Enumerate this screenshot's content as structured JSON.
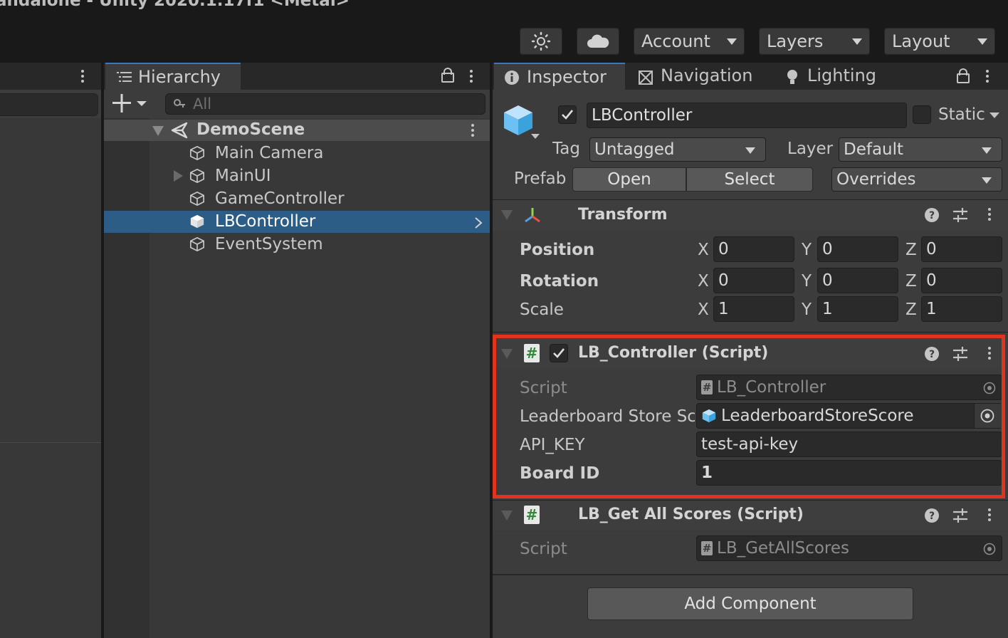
{
  "window": {
    "title": "andalone - Unity 2020.1.17f1 <Metal>"
  },
  "toolbar": {
    "account_label": "Account",
    "layers_label": "Layers",
    "layout_label": "Layout"
  },
  "hierarchy": {
    "tab_label": "Hierarchy",
    "search_placeholder": "All",
    "scene_name": "DemoScene",
    "items": [
      {
        "label": "Main Camera"
      },
      {
        "label": "MainUI"
      },
      {
        "label": "GameController"
      },
      {
        "label": "LBController"
      },
      {
        "label": "EventSystem"
      }
    ]
  },
  "inspector": {
    "tabs": [
      {
        "label": "Inspector"
      },
      {
        "label": "Navigation"
      },
      {
        "label": "Lighting"
      }
    ],
    "object_name": "LBController",
    "static_label": "Static",
    "tag_label": "Tag",
    "tag_value": "Untagged",
    "layer_label": "Layer",
    "layer_value": "Default",
    "prefab_label": "Prefab",
    "open_label": "Open",
    "select_label": "Select",
    "overrides_label": "Overrides",
    "transform": {
      "title": "Transform",
      "position_label": "Position",
      "rotation_label": "Rotation",
      "scale_label": "Scale",
      "x": "X",
      "y": "Y",
      "z": "Z",
      "position": [
        "0",
        "0",
        "0"
      ],
      "rotation": [
        "0",
        "0",
        "0"
      ],
      "scale": [
        "1",
        "1",
        "1"
      ]
    },
    "lb_controller": {
      "title": "LB_Controller (Script)",
      "script_label": "Script",
      "script_value": "LB_Controller",
      "store_label": "Leaderboard Store Sc",
      "store_value": "LeaderboardStoreScore",
      "api_key_label": "API_KEY",
      "api_key_value": "test-api-key",
      "board_id_label": "Board ID",
      "board_id_value": "1"
    },
    "lb_get_all": {
      "title": "LB_Get All Scores (Script)",
      "script_label": "Script",
      "script_value": "LB_GetAllScores"
    },
    "add_component_label": "Add Component"
  },
  "colors": {
    "highlight_box": "#e2331f",
    "selection": "#2c5d87",
    "accent": "#3a79bb"
  }
}
